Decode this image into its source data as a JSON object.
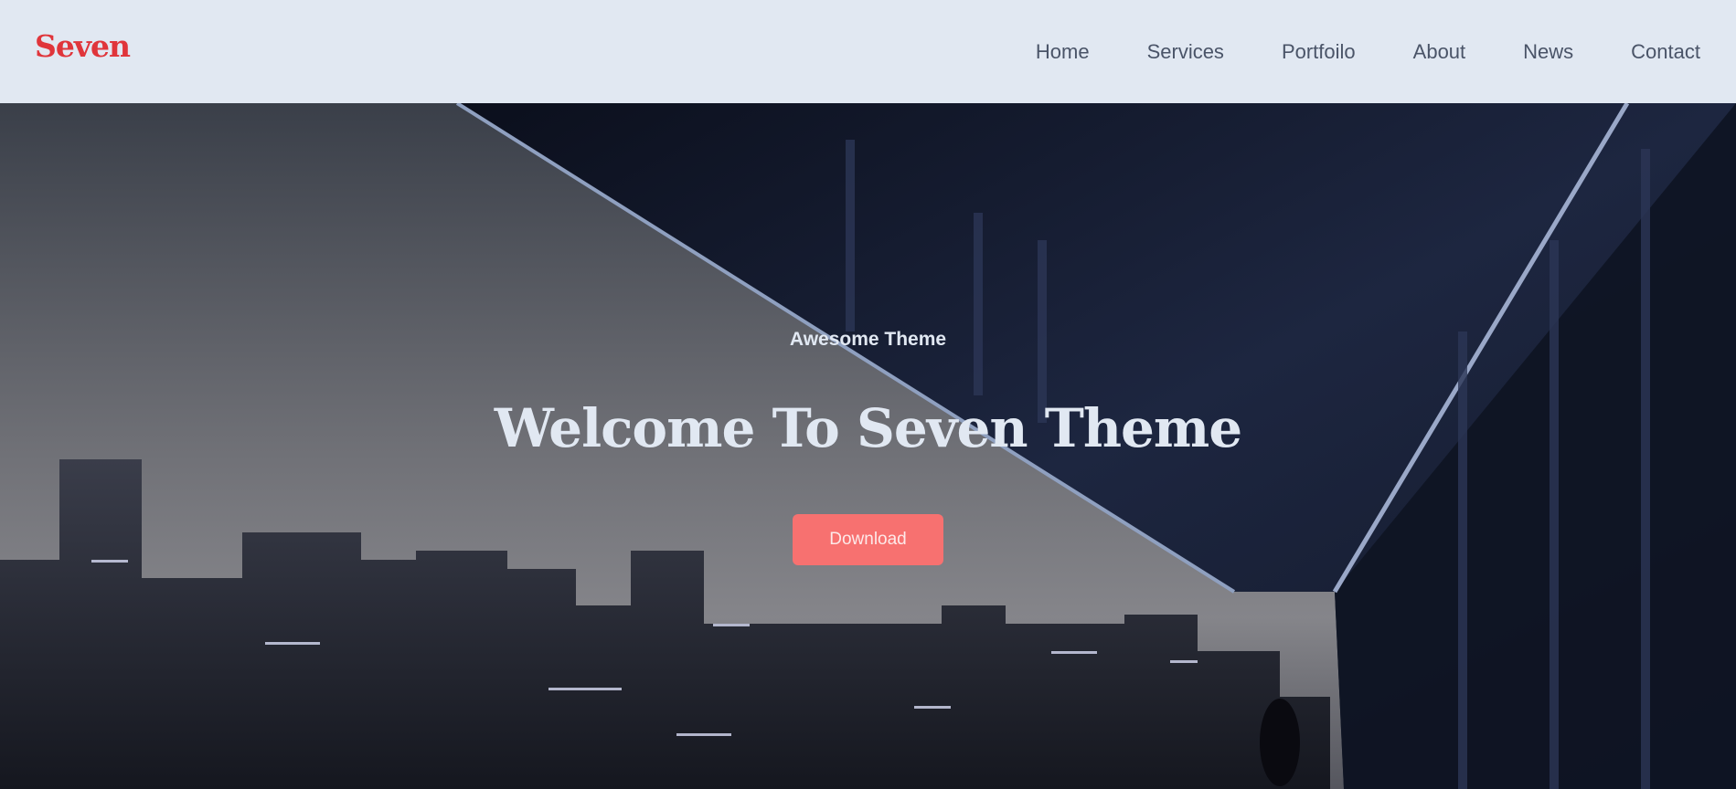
{
  "header": {
    "logo": "Seven",
    "nav": [
      "Home",
      "Services",
      "Portfoilo",
      "About",
      "News",
      "Contact"
    ]
  },
  "hero": {
    "subtitle": "Awesome Theme",
    "title": "Welcome To Seven Theme",
    "button_label": "Download"
  },
  "colors": {
    "header_bg": "#e1e8f2",
    "logo": "#e0353b",
    "button": "#f77170",
    "text": "#e1e8f2"
  }
}
